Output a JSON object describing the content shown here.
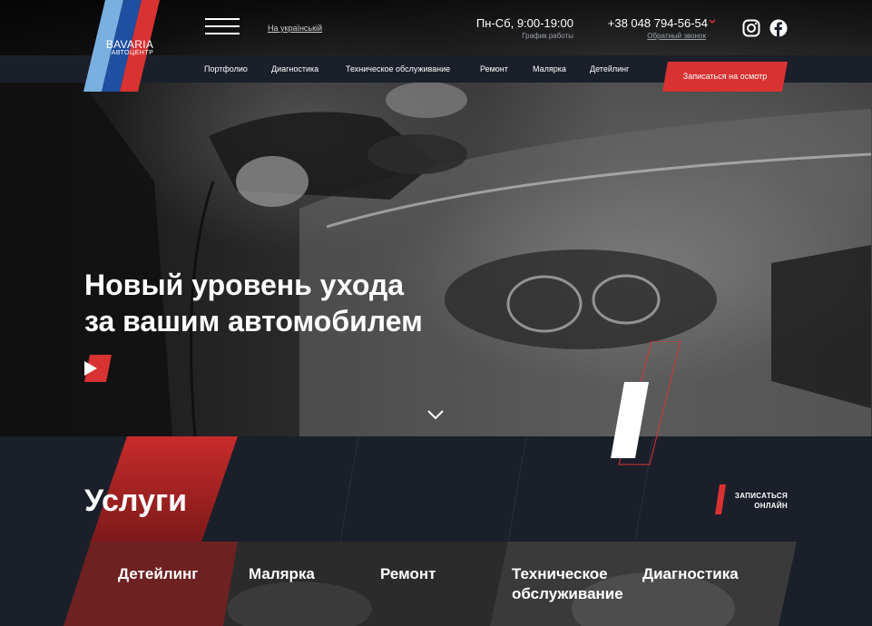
{
  "brand": {
    "name": "BAVARIA",
    "subtitle": "АВТОЦЕНТР"
  },
  "header": {
    "language_link": "На українській",
    "hours": "Пн-Сб, 9:00-19:00",
    "hours_label": "График работы",
    "phone": "+38 048 794-56-54",
    "callback": "Обратный звонок",
    "social": [
      "instagram-icon",
      "facebook-icon"
    ]
  },
  "nav": {
    "items": [
      "Портфолио",
      "Диагностика",
      "Техническое обслуживание",
      "Ремонт",
      "Малярка",
      "Детейлинг"
    ],
    "cta": "Записаться на осмотр"
  },
  "hero": {
    "title_line1": "Новый уровень ухода",
    "title_line2": "за вашим автомобилем"
  },
  "services": {
    "title": "Услуги",
    "online_line1": "ЗАПИСАТЬСЯ",
    "online_line2": "ОНЛАЙН",
    "items": [
      "Детейлинг",
      "Малярка",
      "Ремонт",
      "Техническое обслуживание",
      "Диагностика"
    ],
    "item4_line1": "Техническое",
    "item4_line2": "обслуживание"
  },
  "colors": {
    "accent": "#d93232",
    "blue_dark": "#1f4fa0",
    "blue_light": "#7ab0e0",
    "navy": "#1b1f29"
  }
}
